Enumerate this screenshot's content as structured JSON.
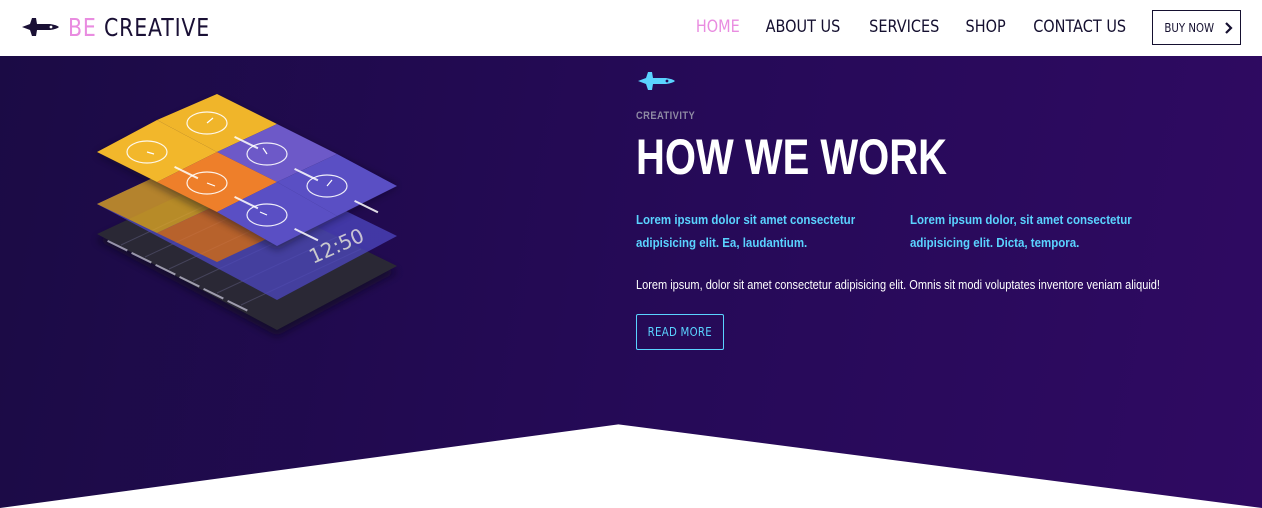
{
  "brand": {
    "prefix": "BE",
    "name": "CREATIVE",
    "icon": "space-shuttle-icon"
  },
  "nav": {
    "items": [
      {
        "label": "HOME",
        "active": true
      },
      {
        "label": "ABOUT US",
        "active": false
      },
      {
        "label": "SERVICES",
        "active": false
      },
      {
        "label": "SHOP",
        "active": false
      },
      {
        "label": "CONTACT US",
        "active": false
      }
    ],
    "buy_button": {
      "label": "BUY NOW",
      "icon": "chevron-right-icon"
    }
  },
  "hero": {
    "eyebrow": "CREATIVITY",
    "title": "HOW WE WORK",
    "lead_left": "Lorem ipsum dolor sit amet consectetur adipisicing elit. Ea, laudantium.",
    "lead_right": "Lorem ipsum dolor, sit amet consectetur adipisicing elit. Dicta, tempora.",
    "body": "Lorem ipsum, dolor sit amet consectetur adipisicing elit. Omnis sit modi voluptates inventore veniam aliquid!",
    "cta_label": "READ MORE",
    "icon": "space-shuttle-icon",
    "illustration_icon": "isometric-weather-app-illustration",
    "illustration_clock": "12:50"
  },
  "colors": {
    "accent_pink": "#e98ce0",
    "accent_cyan": "#5ad3ff",
    "hero_bg": "#260a58",
    "navy": "#151030"
  }
}
